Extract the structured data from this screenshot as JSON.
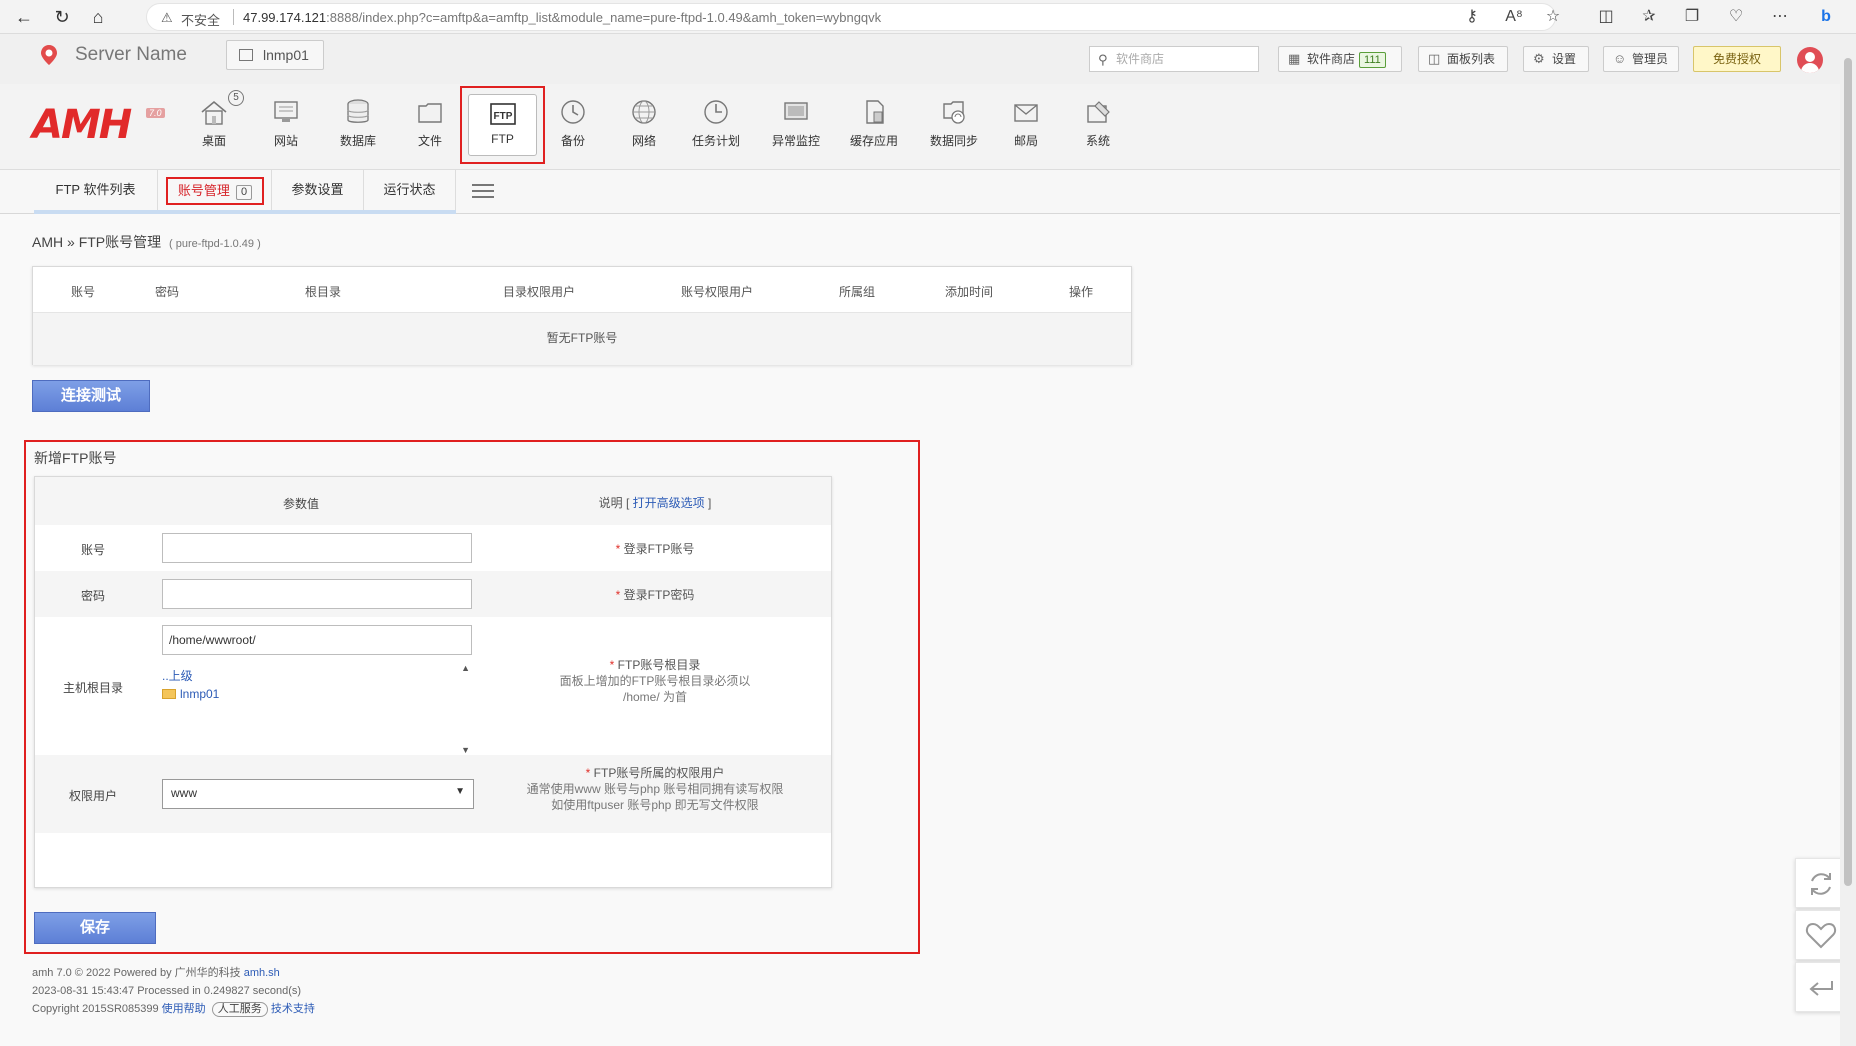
{
  "browser": {
    "insecure_label": "不安全",
    "url_host": "47.99.174.121",
    "url_rest": ":8888/index.php?c=amftp&a=amftp_list&module_name=pure-ftpd-1.0.49&amh_token=wybngqvk"
  },
  "header": {
    "server_name": "Server Name",
    "host_button": "lnmp01",
    "search_placeholder": "软件商店",
    "store_label": "软件商店",
    "store_count": "111",
    "panel_list": "面板列表",
    "settings": "设置",
    "admin": "管理员",
    "free_auth": "免费授权"
  },
  "nav": {
    "logo": "AMH",
    "logo_version": "7.0",
    "desktop_badge": "5",
    "items": [
      {
        "label": "桌面"
      },
      {
        "label": "网站"
      },
      {
        "label": "数据库"
      },
      {
        "label": "文件"
      },
      {
        "label": "FTP"
      },
      {
        "label": "备份"
      },
      {
        "label": "网络"
      },
      {
        "label": "任务计划"
      },
      {
        "label": "异常监控"
      },
      {
        "label": "缓存应用"
      },
      {
        "label": "数据同步"
      },
      {
        "label": "邮局"
      },
      {
        "label": "系统"
      }
    ]
  },
  "subtabs": {
    "software_list": "FTP 软件列表",
    "account_manage": "账号管理",
    "account_count": "0",
    "params": "参数设置",
    "status": "运行状态"
  },
  "breadcrumb": {
    "root": "AMH",
    "sep": "»",
    "page": "FTP账号管理",
    "module": "( pure-ftpd-1.0.49 )"
  },
  "account_table": {
    "columns": [
      "账号",
      "密码",
      "根目录",
      "目录权限用户",
      "账号权限用户",
      "所属组",
      "添加时间",
      "操作"
    ],
    "empty_text": "暂无FTP账号"
  },
  "connect_test_button": "连接测试",
  "new_account": {
    "title": "新增FTP账号",
    "col_value": "参数值",
    "col_desc": "说明 [",
    "col_adv": "打开高级选项",
    "col_desc_end": "]",
    "account_label": "账号",
    "account_value": "",
    "account_desc": "登录FTP账号",
    "password_label": "密码",
    "password_value": "",
    "password_desc": "登录FTP密码",
    "root_label": "主机根目录",
    "root_value": "/home/wwwroot/",
    "dir_up": "..上级",
    "dir_folder": "lnmp01",
    "root_desc": "FTP账号根目录",
    "root_note1": "面板上增加的FTP账号根目录必须以",
    "root_note2": "/home/ 为首",
    "user_label": "权限用户",
    "user_selected": "www",
    "user_desc": "FTP账号所属的权限用户",
    "user_note1": "通常使用www 账号与php 账号相同拥有读写权限",
    "user_note2": "如使用ftpuser 账号php 即无写文件权限",
    "required_mark": "*"
  },
  "save_button": "保存",
  "footer": {
    "line1_prefix": "amh 7.0 © 2022 Powered by 广州华的科技",
    "line1_link": "amh.sh",
    "line2": "2023-08-31 15:43:47 Processed in 0.249827 second(s)",
    "line3_prefix": "Copyright 2015SR085399",
    "help": "使用帮助",
    "manual": "人工服务",
    "support": "技术支持"
  },
  "colors": {
    "accent_red": "#e02020",
    "logo_red": "#e12a2a",
    "button_blue": "#5d7fd6",
    "link_blue": "#2c5bb6"
  }
}
